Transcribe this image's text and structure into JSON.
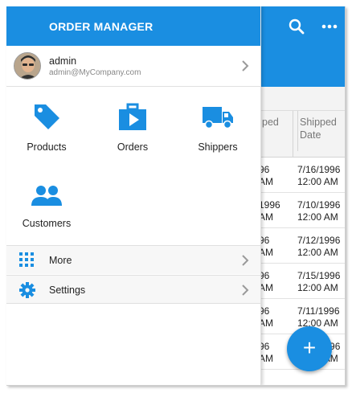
{
  "drawer": {
    "title": "ORDER MANAGER",
    "account": {
      "name": "admin",
      "email": "admin@MyCompany.com"
    },
    "tiles": [
      {
        "label": "Products",
        "icon": "tag-icon"
      },
      {
        "label": "Orders",
        "icon": "play-briefcase-icon"
      },
      {
        "label": "Shippers",
        "icon": "truck-icon"
      },
      {
        "label": "Customers",
        "icon": "people-icon"
      }
    ],
    "menu": [
      {
        "label": "More",
        "icon": "apps-grid-icon"
      },
      {
        "label": "Settings",
        "icon": "gear-icon"
      }
    ]
  },
  "app": {
    "columns": {
      "partial": "ped",
      "shipped_date": "Shipped Date",
      "shipped_line1": "Shipped",
      "shipped_line2": "Date"
    },
    "rows": [
      {
        "a1": "96",
        "a2": "AM",
        "date": "7/16/1996",
        "time": "12:00 AM"
      },
      {
        "a1": "1996",
        "a2": "AM",
        "date": "7/10/1996",
        "time": "12:00 AM"
      },
      {
        "a1": "96",
        "a2": "AM",
        "date": "7/12/1996",
        "time": "12:00 AM"
      },
      {
        "a1": "96",
        "a2": "AM",
        "date": "7/15/1996",
        "time": "12:00 AM"
      },
      {
        "a1": "96",
        "a2": "AM",
        "date": "7/11/1996",
        "time": "12:00 AM"
      },
      {
        "a1": "96",
        "a2": "AM",
        "date": "7/23/1996",
        "time": "12:00 AM"
      }
    ],
    "fab_label": "+"
  },
  "colors": {
    "accent": "#1a8ee1"
  }
}
